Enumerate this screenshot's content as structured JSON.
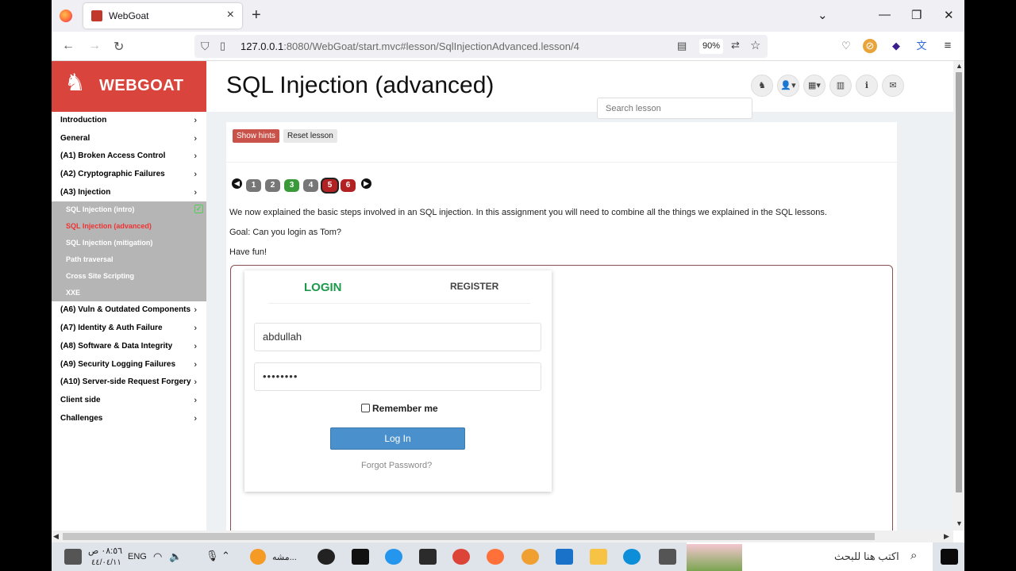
{
  "browser": {
    "tab_title": "WebGoat",
    "url_host": "127.0.0.1",
    "url_rest": ":8080/WebGoat/start.mvc#lesson/SqlInjectionAdvanced.lesson/4",
    "zoom": "90%"
  },
  "brand": {
    "name": "WEBGOAT"
  },
  "sidebar": {
    "items": [
      {
        "label": "Introduction"
      },
      {
        "label": "General"
      },
      {
        "label": "(A1) Broken Access Control"
      },
      {
        "label": "(A2) Cryptographic Failures"
      },
      {
        "label": "(A3) Injection"
      }
    ],
    "subitems": [
      {
        "label": "SQL Injection (intro)",
        "completed": true
      },
      {
        "label": "SQL Injection (advanced)",
        "active": true
      },
      {
        "label": "SQL Injection (mitigation)"
      },
      {
        "label": "Path traversal"
      },
      {
        "label": "Cross Site Scripting"
      },
      {
        "label": "XXE"
      }
    ],
    "items_after": [
      {
        "label": "(A6) Vuln & Outdated Components"
      },
      {
        "label": "(A7) Identity & Auth Failure"
      },
      {
        "label": "(A8) Software & Data Integrity"
      },
      {
        "label": "(A9) Security Logging Failures"
      },
      {
        "label": "(A10) Server-side Request Forgery"
      },
      {
        "label": "Client side"
      },
      {
        "label": "Challenges"
      }
    ]
  },
  "main": {
    "title": "SQL Injection (advanced)",
    "search_placeholder": "Search lesson",
    "show_hints": "Show hints",
    "reset_lesson": "Reset lesson",
    "pages": [
      "1",
      "2",
      "3",
      "4",
      "5",
      "6"
    ],
    "current_page": "5",
    "para1": "We now explained the basic steps involved in an SQL injection. In this assignment you will need to combine all the things we explained in the SQL lessons.",
    "para2": "Goal: Can you login as Tom?",
    "para3": "Have fun!"
  },
  "login_form": {
    "tab_login": "LOGIN",
    "tab_register": "REGISTER",
    "username": "abdullah",
    "password": "••••••••",
    "remember": "Remember me",
    "login_button": "Log In",
    "forgot": "Forgot Password?"
  },
  "taskbar": {
    "search_text": "اكتب هنا للبحث",
    "time": "٠٨:٥٦ ص",
    "date": "٤٤/٠٤/١١",
    "lang": "ENG",
    "app_label": "مشه..."
  }
}
